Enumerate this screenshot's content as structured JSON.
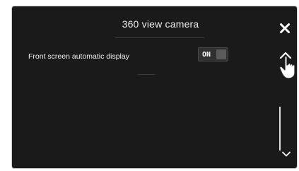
{
  "screen": {
    "title": "360 view camera"
  },
  "settings": [
    {
      "label": "Front screen automatic display",
      "value": "ON"
    }
  ],
  "icons": {
    "close": "close-icon",
    "scroll_up": "chevron-up-icon",
    "scroll_down": "chevron-down-icon",
    "pointer": "hand-pointer-icon"
  },
  "colors": {
    "background": "#1a1a1a",
    "text": "#f0f0f0",
    "toggle_bg": "#303030"
  }
}
